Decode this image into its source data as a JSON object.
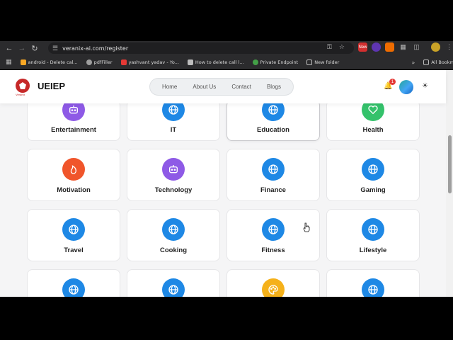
{
  "browser": {
    "url": "veranix-ai.com/register",
    "bookmarks": [
      {
        "label": "android - Delete cal...",
        "icon_color": "#f9a825"
      },
      {
        "label": "pdfFiller",
        "icon_color": "#9e9e9e"
      },
      {
        "label": "yashvant yadav - Yo...",
        "icon_color": "#e53935"
      },
      {
        "label": "How to delete call l...",
        "icon_color": "#bdbdbd"
      },
      {
        "label": "Private Endpoint",
        "icon_color": "#43a047"
      },
      {
        "label": "New folder",
        "icon_color": "#9e9e9e"
      }
    ],
    "all_bookmarks": "All Bookmarks",
    "ext_new": "New"
  },
  "header": {
    "brand": "UEIEP",
    "logo_sub": "Veranix",
    "menu": [
      "Home",
      "About Us",
      "Contact",
      "Blogs"
    ],
    "notification_count": "1"
  },
  "categories": [
    {
      "label": "Entertainment",
      "icon": "robot-icon",
      "color": "#8e5ae6"
    },
    {
      "label": "IT",
      "icon": "globe-icon",
      "color": "#1e88e5"
    },
    {
      "label": "Education",
      "icon": "globe-icon",
      "color": "#1e88e5"
    },
    {
      "label": "Health",
      "icon": "heart-icon",
      "color": "#34c26b"
    },
    {
      "label": "Motivation",
      "icon": "flame-icon",
      "color": "#f0552b"
    },
    {
      "label": "Technology",
      "icon": "robot-icon",
      "color": "#8e5ae6"
    },
    {
      "label": "Finance",
      "icon": "globe-icon",
      "color": "#1e88e5"
    },
    {
      "label": "Gaming",
      "icon": "globe-icon",
      "color": "#1e88e5"
    },
    {
      "label": "Travel",
      "icon": "globe-icon",
      "color": "#1e88e5"
    },
    {
      "label": "Cooking",
      "icon": "globe-icon",
      "color": "#1e88e5"
    },
    {
      "label": "Fitness",
      "icon": "globe-icon",
      "color": "#1e88e5"
    },
    {
      "label": "Lifestyle",
      "icon": "globe-icon",
      "color": "#1e88e5"
    },
    {
      "label": "",
      "icon": "globe-icon",
      "color": "#1e88e5"
    },
    {
      "label": "",
      "icon": "globe-icon",
      "color": "#1e88e5"
    },
    {
      "label": "",
      "icon": "palette-icon",
      "color": "#f5b11a"
    },
    {
      "label": "",
      "icon": "globe-icon",
      "color": "#1e88e5"
    }
  ]
}
